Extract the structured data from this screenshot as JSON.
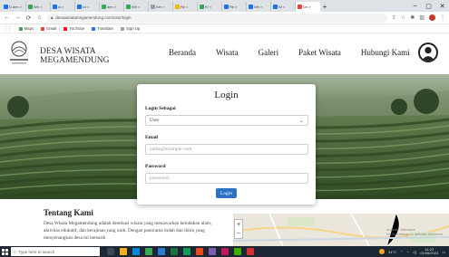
{
  "browser": {
    "tabs": [
      {
        "label": "D den",
        "color": "#1a73e8"
      },
      {
        "label": "Wir",
        "color": "#3aa757"
      },
      {
        "label": "ul",
        "color": "#1a73e8"
      },
      {
        "label": "Ur",
        "color": "#1a73e8"
      },
      {
        "label": "den",
        "color": "#3aa757"
      },
      {
        "label": "Wir",
        "color": "#3aa757"
      },
      {
        "label": "Ker",
        "color": "#9aa0a6"
      },
      {
        "label": "Re",
        "color": "#f4b400"
      },
      {
        "label": "Kl",
        "color": "#3aa757"
      },
      {
        "label": "Re",
        "color": "#1a73e8"
      },
      {
        "label": "Wir",
        "color": "#1a73e8"
      },
      {
        "label": "W",
        "color": "#1a73e8"
      },
      {
        "label": "De",
        "color": "#ea4335"
      }
    ],
    "url": "desawisatamegamendung.com/user/login",
    "bookmarks": [
      {
        "label": "Maps",
        "color": "#3aa757"
      },
      {
        "label": "Gmail",
        "color": "#ea4335"
      },
      {
        "label": "YouTube",
        "color": "#ff0000"
      },
      {
        "label": "Translate",
        "color": "#1a73e8"
      },
      {
        "label": "Sign Up",
        "color": "#9aa0a6"
      }
    ]
  },
  "site": {
    "logo_line1": "DESA WISATA",
    "logo_line2": "MEGAMENDUNG",
    "logo_caption": "DESA WISATA MEGA MEDIA",
    "nav": [
      "Beranda",
      "Wisata",
      "Galeri",
      "Paket Wisata",
      "Hubungi Kami"
    ]
  },
  "login": {
    "title": "Login",
    "role_label": "Login Sebagai",
    "role_value": "User",
    "email_label": "Email",
    "email_placeholder": "name@example.com",
    "password_label": "Password",
    "password_placeholder": "password",
    "button": "Login"
  },
  "about": {
    "title": "Tentang Kami",
    "text": "Desa Wisata Megamendung adalah destinasi wisata yang menawarkan keindahan alam, aktivitas edukatif, dan kerajinan yang unik. Dengan panorama indah dan iklim yang menyenangkan desa ini menarik"
  },
  "map": {
    "zoom_in": "+",
    "zoom_out": "−",
    "watermark": "Activate Windows\nGo to Settings to activate Windows."
  },
  "taskbar": {
    "search_placeholder": "Type here to search",
    "weather": "34°C",
    "time": "14:23",
    "date": "01/06/2023"
  }
}
